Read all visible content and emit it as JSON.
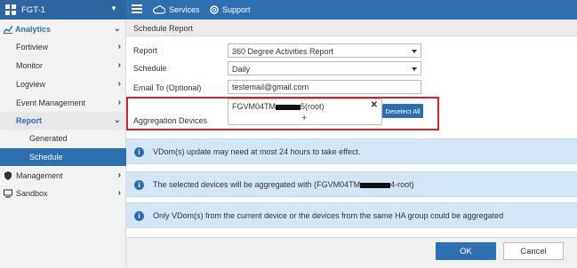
{
  "header": {
    "device_name": "FGT-1",
    "services_label": "Services",
    "support_label": "Support"
  },
  "sidebar": {
    "analytics": "Analytics",
    "items": {
      "fortiview": "Fortiview",
      "monitor": "Monitor",
      "logview": "Logview",
      "event_management": "Event Management",
      "report": "Report",
      "generated": "Generated",
      "schedule": "Schedule",
      "management": "Management",
      "sandbox": "Sandbox"
    }
  },
  "panel": {
    "title": "Schedule Report",
    "report_label": "Report",
    "report_value": "360 Degree Activities Report",
    "schedule_label": "Schedule",
    "schedule_value": "Daily",
    "email_label": "Email To (Optional)",
    "email_value": "testemail@gmail.com",
    "aggregation_label": "Aggregation Devices",
    "device_prefix": "FGVM04TM",
    "device_suffix": "5(root)",
    "deselect_label": "Deselect All",
    "add_symbol": "+",
    "remove_symbol": "✕"
  },
  "info": {
    "msg1": "VDom(s) update may need at most 24 hours to take effect.",
    "msg2_prefix": "The selected devices will be aggregated with (FGVM04TM",
    "msg2_suffix": "4-root)",
    "msg3": "Only VDom(s) from the current device or the devices from the same HA group could be aggregated"
  },
  "footer": {
    "ok_label": "OK",
    "cancel_label": "Cancel"
  },
  "colors": {
    "primary": "#2d6fb0",
    "highlight_border": "#c8242b",
    "info_background": "#d4e6f6"
  }
}
